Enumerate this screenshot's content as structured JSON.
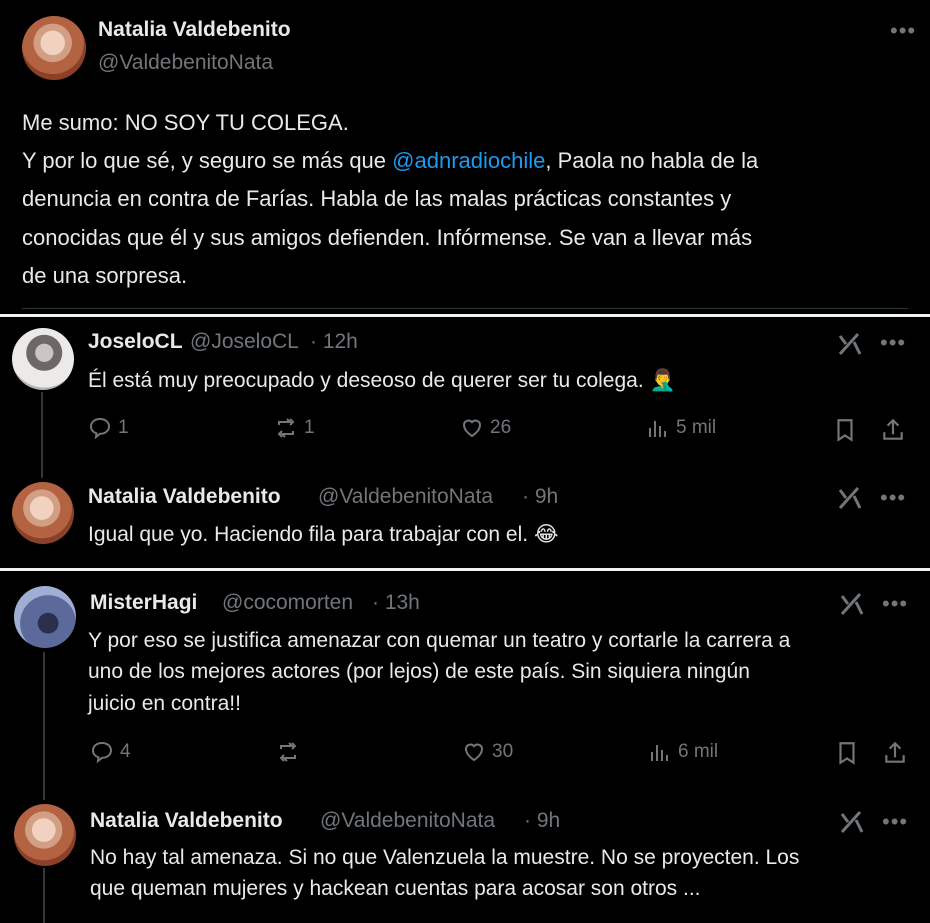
{
  "main_tweet": {
    "name": "Natalia Valdebenito",
    "handle": "@ValdebenitoNata",
    "line1": "Me sumo: NO SOY TU COLEGA.",
    "line2_a": "Y por lo que sé, y seguro se más que ",
    "line2_mention": "@adnradiochile",
    "line2_b": ", Paola no habla de la",
    "line3": "denuncia en contra de Farías. Habla de las malas prácticas constantes y",
    "line4": "conocidas que él y sus amigos defienden. Infórmense. Se van a llevar más",
    "line5": "de una sorpresa."
  },
  "replies": [
    {
      "name": "JoseloCL",
      "handle": "@JoseloCL",
      "time": "· 12h",
      "text": "Él está muy preocupado y deseoso de querer ser tu colega. 🤦‍♂️",
      "replies_count": "1",
      "reposts_count": "1",
      "likes_count": "26",
      "views_count": "5 mil"
    },
    {
      "name": "Natalia Valdebenito",
      "handle": "@ValdebenitoNata",
      "time": "· 9h",
      "text": "Igual que yo. Haciendo fila para trabajar con el. 😂"
    },
    {
      "name": "MisterHagi",
      "handle": "@cocomorten",
      "time": "· 13h",
      "line1": "Y por eso se justifica amenazar con quemar un teatro y cortarle la carrera a",
      "line2": "uno de los mejores actores (por lejos) de este país.  Sin siquiera ningún",
      "line3": "juicio en contra!!",
      "replies_count": "4",
      "reposts_count": "",
      "likes_count": "30",
      "views_count": "6 mil"
    },
    {
      "name": "Natalia Valdebenito",
      "handle": "@ValdebenitoNata",
      "time": "· 9h",
      "line1": "No hay tal amenaza. Si no que Valenzuela la muestre. No se proyecten. Los",
      "line2": "que queman mujeres y hackean cuentas para acosar son otros ..."
    }
  ],
  "colors": {
    "background": "#000000",
    "text": "#e7e9ea",
    "muted": "#71767b",
    "link": "#1d9bf0"
  },
  "icons": [
    "more-icon",
    "grok-icon",
    "reply-icon",
    "repost-icon",
    "like-icon",
    "views-icon",
    "bookmark-icon",
    "share-icon"
  ]
}
